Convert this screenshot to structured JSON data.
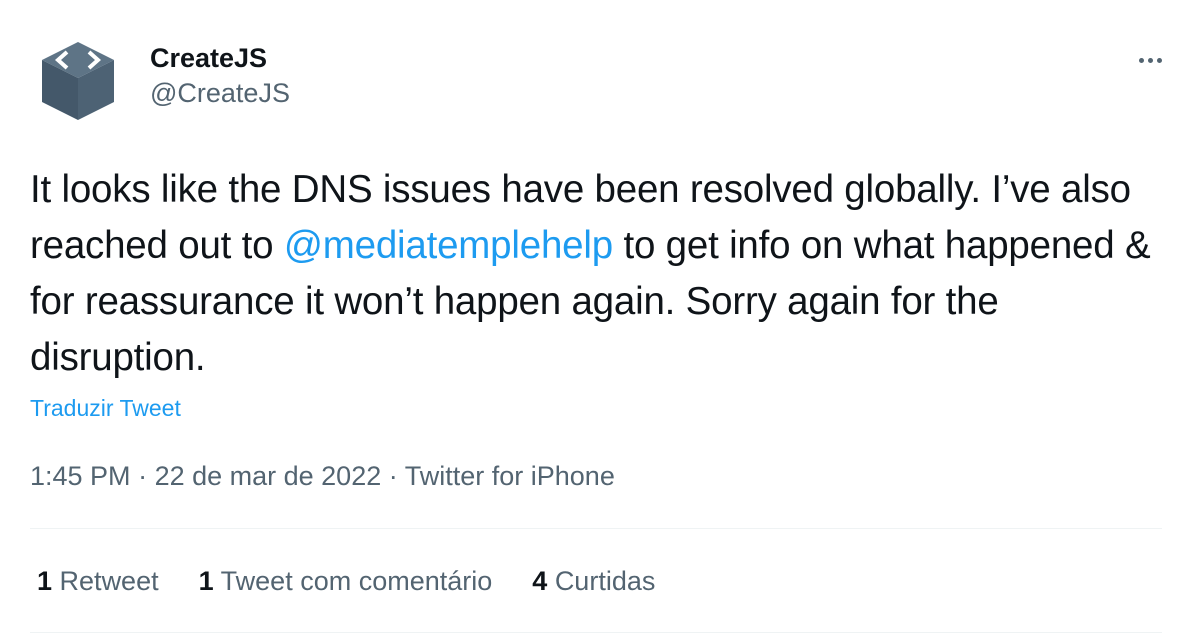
{
  "author": {
    "display_name": "CreateJS",
    "handle": "@CreateJS",
    "avatar_icon": "code-brackets-box-icon",
    "avatar_colors": {
      "top": "#5e7486",
      "side": "#44586a",
      "front": "#4d6274",
      "glyph": "#ffffff"
    }
  },
  "more_icon": "more-horizontal-icon",
  "tweet": {
    "text_part1": "It looks like the DNS issues have been resolved globally. I’ve also reached out to ",
    "mention": "@mediatemplehelp",
    "text_part2": " to get info on what happened & for reassurance it won’t happen again. Sorry again for the disruption.",
    "translate_label": "Traduzir Tweet"
  },
  "meta": {
    "time": "1:45 PM",
    "separator": " · ",
    "date": "22 de mar de 2022",
    "source": "Twitter for iPhone"
  },
  "stats": [
    {
      "count": "1",
      "label": "Retweet"
    },
    {
      "count": "1",
      "label": "Tweet com comentário"
    },
    {
      "count": "4",
      "label": "Curtidas"
    }
  ],
  "colors": {
    "link": "#1d9bf0",
    "secondary_text": "#536471",
    "primary_text": "#0f1419",
    "divider": "#eff3f4"
  }
}
